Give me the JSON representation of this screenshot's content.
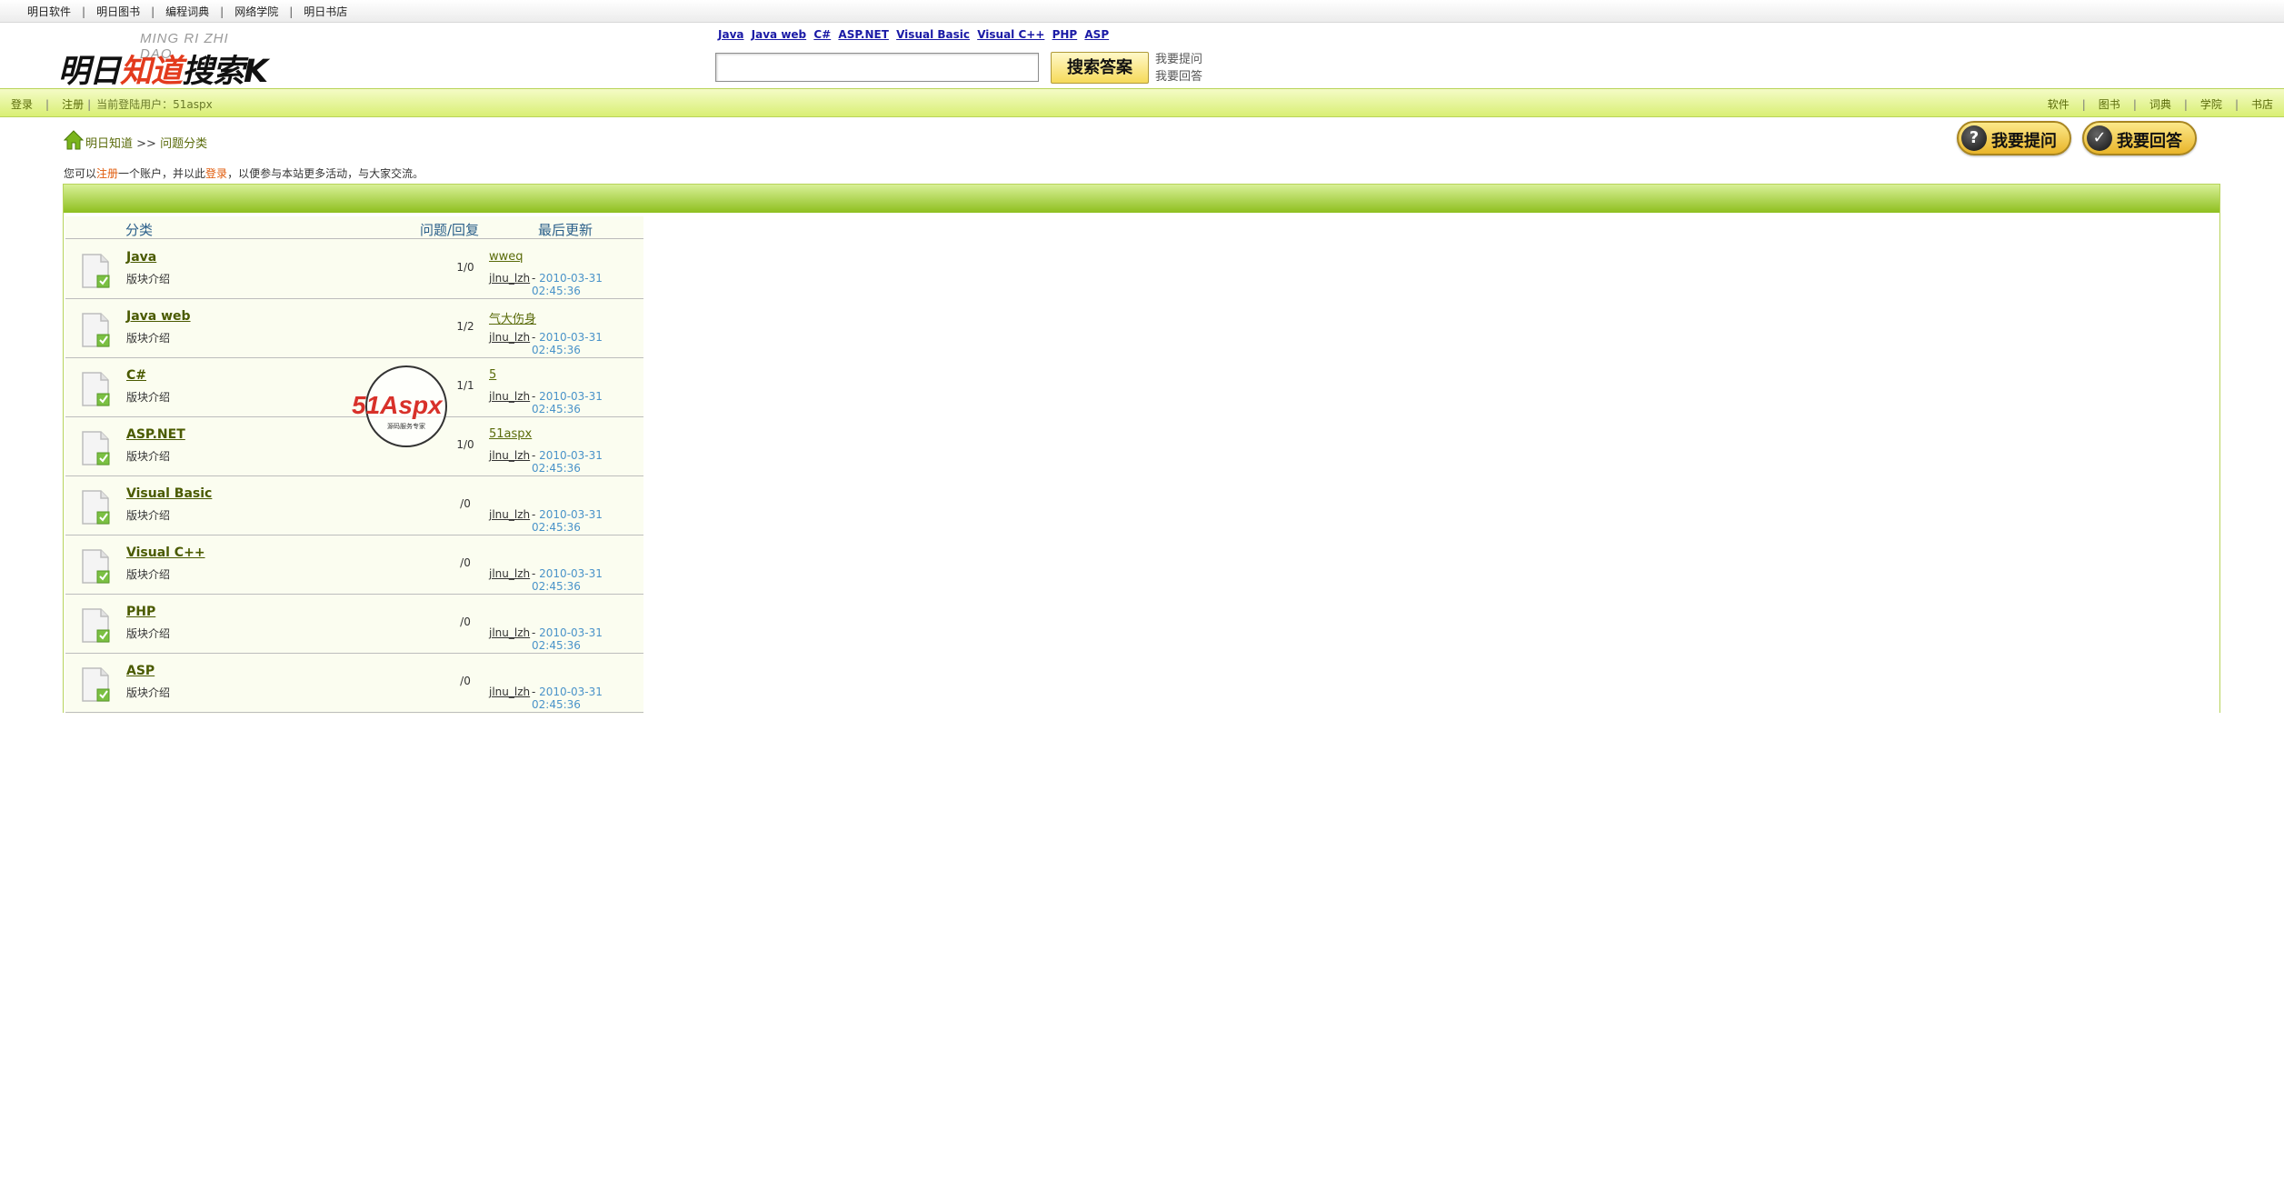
{
  "topbar": {
    "links": [
      "明日软件",
      "明日图书",
      "编程词典",
      "网络学院",
      "明日书店"
    ]
  },
  "logo": {
    "subtitle": "MING RI ZHI DAO",
    "title_black1": "明日",
    "title_red": "知道",
    "title_black2": "搜索",
    "title_suffix": "K"
  },
  "search": {
    "lang_links": [
      "Java",
      "Java web",
      "C#",
      "ASP.NET",
      "Visual Basic",
      "Visual C++",
      "PHP",
      "ASP"
    ],
    "input_value": "",
    "button_label": "搜索答案",
    "ask_link": "我要提问",
    "answer_link": "我要回答"
  },
  "navbar": {
    "login": "登录",
    "register": "注册",
    "current_user": "当前登陆用户：51aspx",
    "right_links": [
      "软件",
      "图书",
      "词典",
      "学院",
      "书店"
    ]
  },
  "breadcrumb": {
    "home": "明日知道",
    "separator": ">>",
    "current": "问题分类"
  },
  "notice": {
    "prefix": "您可以",
    "register": "注册",
    "middle": "一个账户，并以此",
    "login": "登录",
    "suffix": "，以便参与本站更多活动，与大家交流。"
  },
  "actions": {
    "ask": "我要提问",
    "answer": "我要回答"
  },
  "table": {
    "headers": [
      "分类",
      "问题/回复",
      "最后更新"
    ],
    "rows": [
      {
        "name": "Java",
        "desc": "版块介绍",
        "count": "1/0",
        "latest": "wweq",
        "user": "jlnu_lzh",
        "date": "2010-03-31 02:45:36"
      },
      {
        "name": "Java web",
        "desc": "版块介绍",
        "count": "1/2",
        "latest": "气大伤身",
        "user": "jlnu_lzh",
        "date": "2010-03-31 02:45:36"
      },
      {
        "name": "C#",
        "desc": "版块介绍",
        "count": "1/1",
        "latest": "5",
        "user": "jlnu_lzh",
        "date": "2010-03-31 02:45:36"
      },
      {
        "name": "ASP.NET",
        "desc": "版块介绍",
        "count": "1/0",
        "latest": "51aspx",
        "user": "jlnu_lzh",
        "date": "2010-03-31 02:45:36"
      },
      {
        "name": "Visual Basic",
        "desc": "版块介绍",
        "count": "/0",
        "latest": "",
        "user": "jlnu_lzh",
        "date": "2010-03-31 02:45:36"
      },
      {
        "name": "Visual C++",
        "desc": "版块介绍",
        "count": "/0",
        "latest": "",
        "user": "jlnu_lzh",
        "date": "2010-03-31 02:45:36"
      },
      {
        "name": "PHP",
        "desc": "版块介绍",
        "count": "/0",
        "latest": "",
        "user": "jlnu_lzh",
        "date": "2010-03-31 02:45:36"
      },
      {
        "name": "ASP",
        "desc": "版块介绍",
        "count": "/0",
        "latest": "",
        "user": "jlnu_lzh",
        "date": "2010-03-31 02:45:36"
      }
    ]
  },
  "watermark": {
    "brand": "51Aspx",
    "tagline": "源码服务专家"
  },
  "colors": {
    "accent_green": "#8ebf1f",
    "nav_green": "#d9ef74",
    "link_olive": "#5a6b0a",
    "date_blue": "#4a93c9",
    "button_gold": "#e9b52a"
  }
}
